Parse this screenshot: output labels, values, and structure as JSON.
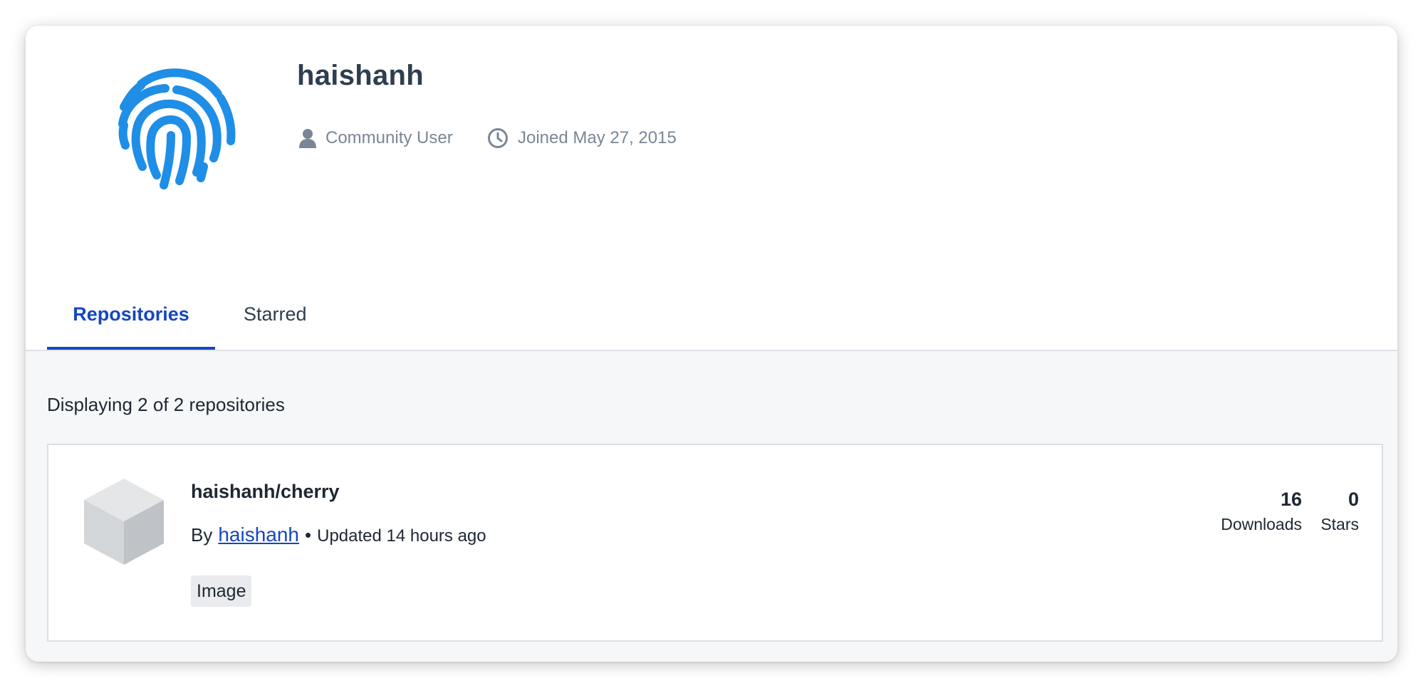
{
  "profile": {
    "username": "haishanh",
    "role": "Community User",
    "joined": "Joined May 27, 2015",
    "avatar_icon": "fingerprint-icon",
    "avatar_color": "#1f8ee6"
  },
  "tabs": [
    {
      "label": "Repositories",
      "active": true
    },
    {
      "label": "Starred",
      "active": false
    }
  ],
  "content": {
    "display_count": "Displaying 2 of 2 repositories"
  },
  "repositories": [
    {
      "name": "haishanh/cherry",
      "by_label": "By",
      "owner": "haishanh",
      "separator": "•",
      "updated": "Updated 14 hours ago",
      "badge": "Image",
      "downloads": "16",
      "downloads_label": "Downloads",
      "stars": "0",
      "stars_label": "Stars",
      "icon": "cube-icon"
    }
  ],
  "colors": {
    "accent": "#1547c0",
    "text_dark": "#2e3e4f",
    "text_muted": "#7a8695",
    "content_bg": "#f6f7f9"
  }
}
